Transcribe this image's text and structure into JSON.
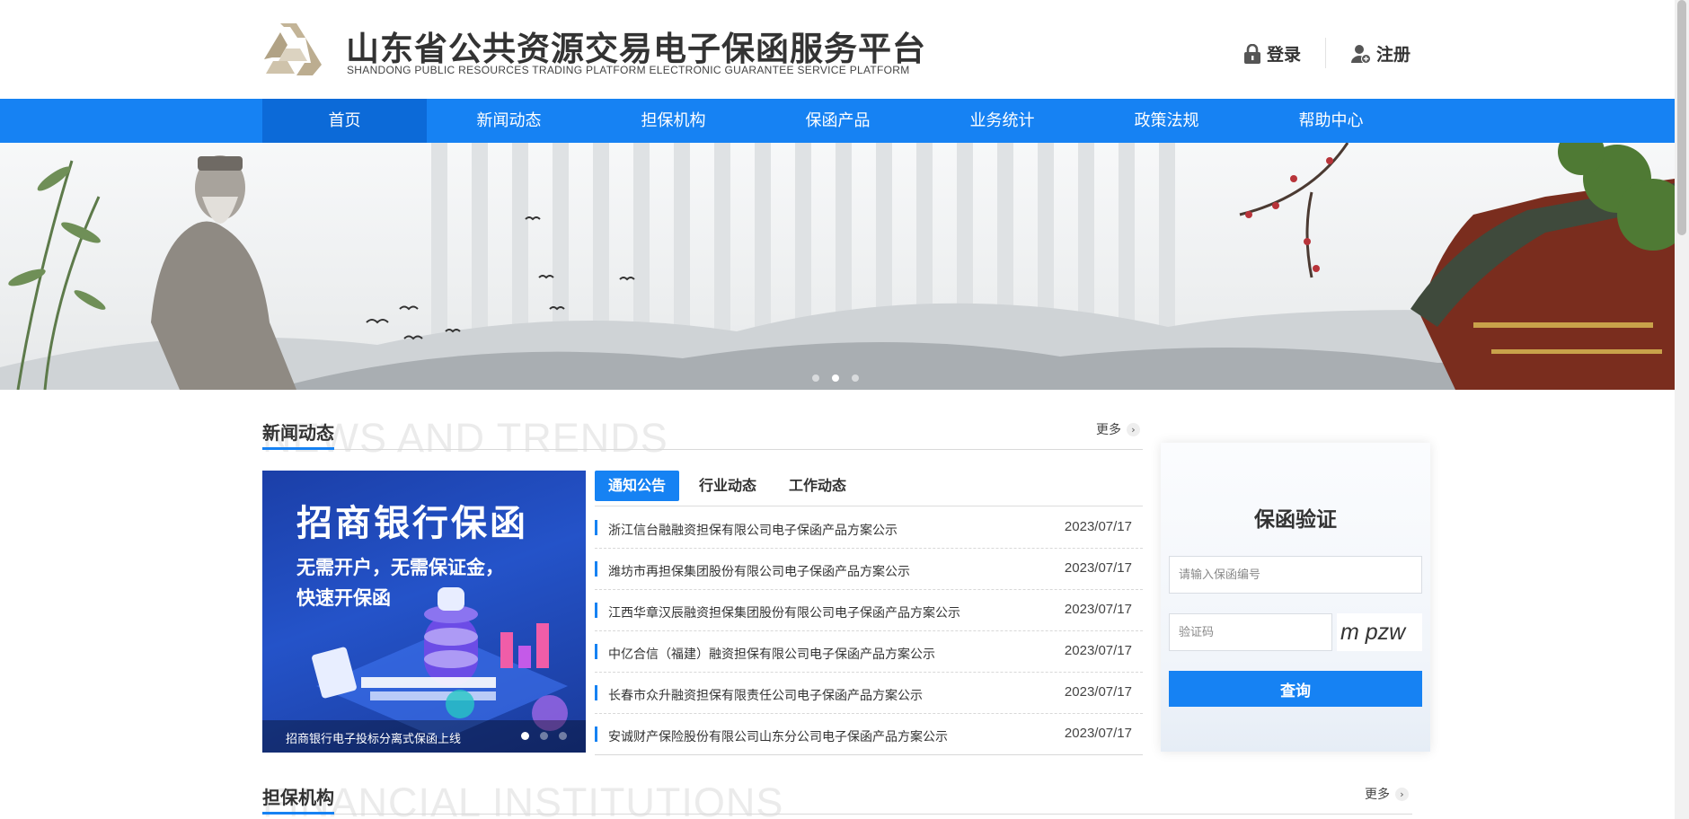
{
  "header": {
    "site_title": "山东省公共资源交易电子保函服务平台",
    "site_subtitle": "SHANDONG PUBLIC RESOURCES TRADING PLATFORM ELECTRONIC GUARANTEE SERVICE PLATFORM",
    "login_label": "登录",
    "register_label": "注册"
  },
  "nav": {
    "items": [
      {
        "label": "首页"
      },
      {
        "label": "新闻动态"
      },
      {
        "label": "担保机构"
      },
      {
        "label": "保函产品"
      },
      {
        "label": "业务统计"
      },
      {
        "label": "政策法规"
      },
      {
        "label": "帮助中心"
      }
    ],
    "active_index": 0
  },
  "banner": {
    "slide_count": 3,
    "active_slide": 1
  },
  "news_section": {
    "title": "新闻动态",
    "watermark": "NEWS AND TRENDS",
    "more_label": "更多",
    "promo": {
      "title": "招商银行保函",
      "line1": "无需开户，无需保证金，",
      "line2": "快速开保函",
      "caption": "招商银行电子投标分离式保函上线",
      "slide_count": 3,
      "active_slide": 0
    },
    "tabs": [
      {
        "label": "通知公告"
      },
      {
        "label": "行业动态"
      },
      {
        "label": "工作动态"
      }
    ],
    "active_tab": 0,
    "items": [
      {
        "title": "浙江信台融融资担保有限公司电子保函产品方案公示",
        "date": "2023/07/17"
      },
      {
        "title": "潍坊市再担保集团股份有限公司电子保函产品方案公示",
        "date": "2023/07/17"
      },
      {
        "title": "江西华章汉辰融资担保集团股份有限公司电子保函产品方案公示",
        "date": "2023/07/17"
      },
      {
        "title": "中亿合信（福建）融资担保有限公司电子保函产品方案公示",
        "date": "2023/07/17"
      },
      {
        "title": "长春市众升融资担保有限责任公司电子保函产品方案公示",
        "date": "2023/07/17"
      },
      {
        "title": "安诚财产保险股份有限公司山东分公司电子保函产品方案公示",
        "date": "2023/07/17"
      }
    ]
  },
  "verify": {
    "title": "保函验证",
    "guarantee_placeholder": "请输入保函编号",
    "captcha_placeholder": "验证码",
    "captcha_text": "m pzw",
    "query_label": "查询"
  },
  "institutions_section": {
    "title": "担保机构",
    "watermark": "FINANCIAL INSTITUTIONS",
    "more_label": "更多"
  },
  "colors": {
    "primary": "#1682f3",
    "nav_active": "#0c6ad8",
    "logo_gold": "#b8a78a"
  },
  "icons": {
    "login": "lock-icon",
    "register": "user-add-icon",
    "more": "chevron-right-icon"
  }
}
